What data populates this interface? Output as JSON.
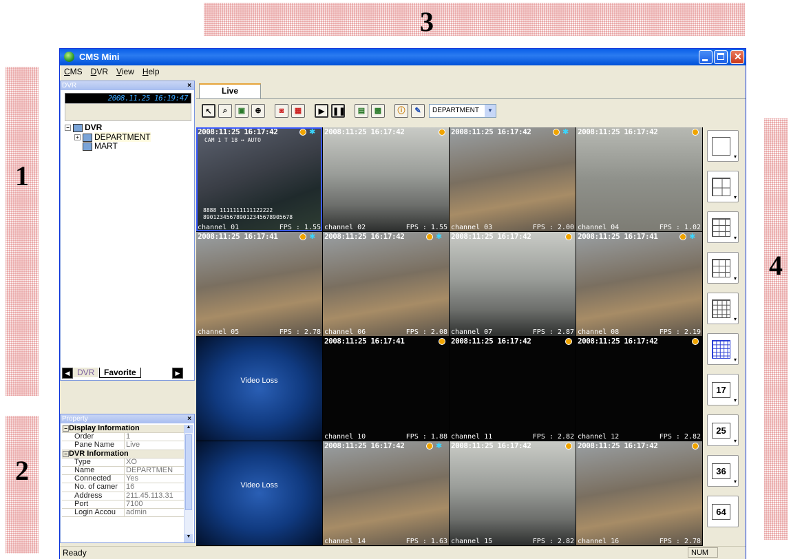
{
  "callouts": [
    "1",
    "2",
    "3",
    "4"
  ],
  "window": {
    "title": "CMS Mini",
    "menu": [
      "CMS",
      "DVR",
      "View",
      "Help"
    ]
  },
  "dvr_panel": {
    "title": "DVR",
    "clock": "2008.11.25 16:19:47",
    "tree": [
      {
        "label": "DVR",
        "level": 0
      },
      {
        "label": "DEPARTMENT",
        "level": 1
      },
      {
        "label": "MART",
        "level": 1
      }
    ],
    "tabs": [
      "DVR",
      "Favorite"
    ]
  },
  "property_panel": {
    "title": "Property",
    "rows": [
      {
        "key": "Display Information",
        "value": "",
        "header": true
      },
      {
        "key": "Order",
        "value": "1"
      },
      {
        "key": "Pane Name",
        "value": "Live"
      },
      {
        "key": "DVR Information",
        "value": "",
        "header": true
      },
      {
        "key": "Type",
        "value": "XO"
      },
      {
        "key": "Name",
        "value": "DEPARTMEN"
      },
      {
        "key": "Connected",
        "value": "Yes"
      },
      {
        "key": "No. of camer",
        "value": "16"
      },
      {
        "key": "Address",
        "value": "211.45.113.31"
      },
      {
        "key": "Port",
        "value": "7100"
      },
      {
        "key": "Login Accou",
        "value": "admin"
      }
    ]
  },
  "main": {
    "tab": "Live",
    "dvr_select": "DEPARTMENT",
    "toolbar_icons": [
      "select-pointer-icon",
      "zoom-icon",
      "fit-icon",
      "fullscreen-icon",
      "record-icon",
      "snapshot-icon",
      "play-icon",
      "pause-icon",
      "layout-icon",
      "save-icon",
      "info-icon",
      "settings-icon"
    ]
  },
  "cameras": [
    {
      "ts": "2008:11:25  16:17:42",
      "channel": "channel 01",
      "fps": "FPS : 1.55",
      "overlay1": "CAM 1        T 18 ↔   AUTO",
      "overlay2": "8888   1111111111122222",
      "overlay3": "890123456789012345678905678",
      "motion": true
    },
    {
      "ts": "2008:11:25  16:17:42",
      "channel": "channel 02",
      "fps": "FPS : 1.55",
      "motion": false
    },
    {
      "ts": "2008:11:25  16:17:42",
      "channel": "channel 03",
      "fps": "FPS : 2.00",
      "motion": true
    },
    {
      "ts": "2008:11:25  16:17:42",
      "channel": "channel 04",
      "fps": "FPS : 1.02",
      "motion": false
    },
    {
      "ts": "2008:11:25  16:17:41",
      "channel": "channel 05",
      "fps": "FPS : 2.78",
      "motion": true
    },
    {
      "ts": "2008:11:25  16:17:42",
      "channel": "channel 06",
      "fps": "FPS : 2.08",
      "motion": true
    },
    {
      "ts": "2008:11:25  16:17:42",
      "channel": "channel 07",
      "fps": "FPS : 2.87",
      "motion": false
    },
    {
      "ts": "2008:11:25  16:17:41",
      "channel": "channel 08",
      "fps": "FPS : 2.19",
      "motion": true
    },
    {
      "ts": "",
      "channel": "",
      "fps": "",
      "video_loss": "Video Loss",
      "motion": false
    },
    {
      "ts": "2008:11:25  16:17:41",
      "channel": "channel 10",
      "fps": "FPS : 1.88",
      "motion": false
    },
    {
      "ts": "2008:11:25  16:17:42",
      "channel": "channel 11",
      "fps": "FPS : 2.82",
      "motion": false
    },
    {
      "ts": "2008:11:25  16:17:42",
      "channel": "channel 12",
      "fps": "FPS : 2.82",
      "motion": false
    },
    {
      "ts": "",
      "channel": "",
      "fps": "",
      "video_loss": "Video Loss",
      "motion": false
    },
    {
      "ts": "2008:11:25  16:17:42",
      "channel": "channel 14",
      "fps": "FPS : 1.63",
      "motion": true
    },
    {
      "ts": "2008:11:25  16:17:42",
      "channel": "channel 15",
      "fps": "FPS : 2.82",
      "motion": false
    },
    {
      "ts": "2008:11:25  16:17:42",
      "channel": "channel 16",
      "fps": "FPS : 2.78",
      "motion": false
    }
  ],
  "layouts": [
    "",
    "",
    "",
    "",
    "",
    "",
    "17",
    "25",
    "36",
    "64"
  ],
  "status": {
    "text": "Ready",
    "num": "NUM"
  },
  "colors": {
    "title_bar": "#0a5fe8",
    "callout_fill": "#e9a6a6",
    "selected_cell": "#3b5bff",
    "record_indicator": "#f0a400",
    "clock_text": "#3aa7ff"
  }
}
